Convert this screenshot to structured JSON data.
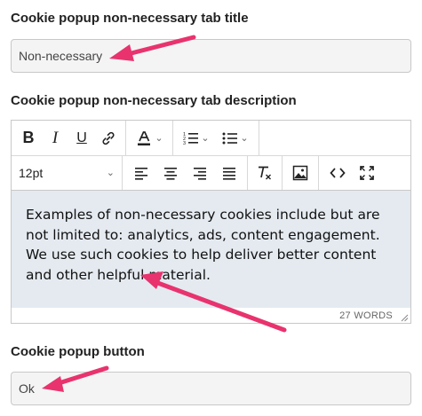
{
  "tab_title": {
    "label": "Cookie popup non-necessary tab title",
    "value": "Non-necessary"
  },
  "tab_description": {
    "label": "Cookie popup non-necessary tab description",
    "toolbar": {
      "font_size": "12pt"
    },
    "content": "Examples of non-necessary cookies include but are not limited to: analytics, ads, content engagement. We use such cookies to help deliver better content and other helpful material.",
    "word_count": "27 WORDS"
  },
  "button": {
    "label": "Cookie popup button",
    "value": "Ok"
  },
  "colors": {
    "arrow": "#e8336e",
    "editor_bg": "#e4eaf0",
    "field_bg": "#f4f4f4"
  },
  "icons": [
    "bold-icon",
    "italic-icon",
    "underline-icon",
    "link-icon",
    "text-color-icon",
    "numbered-list-icon",
    "bullet-list-icon",
    "align-left-icon",
    "align-center-icon",
    "align-right-icon",
    "align-justify-icon",
    "clear-formatting-icon",
    "image-icon",
    "source-code-icon",
    "fullscreen-icon"
  ]
}
